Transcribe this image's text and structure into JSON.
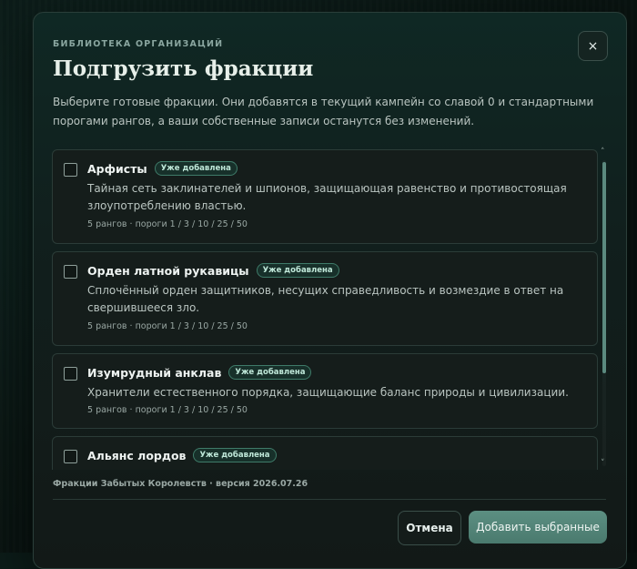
{
  "dialog": {
    "eyebrow": "БИБЛИОТЕКА ОРГАНИЗАЦИЙ",
    "title": "Подгрузить фракции",
    "description": "Выберите готовые фракции. Они добавятся в текущий кампейн со славой 0 и стандартными порогами рангов, а ваши собственные записи останутся без изменений.",
    "close_icon": "×"
  },
  "factions": [
    {
      "name": "Арфисты",
      "badge": "Уже добавлена",
      "description": "Тайная сеть заклинателей и шпионов, защищающая равенство и противостоящая злоупотреблению властью.",
      "meta": "5 рангов · пороги 1 / 3 / 10 / 25 / 50",
      "checked": false
    },
    {
      "name": "Орден латной рукавицы",
      "badge": "Уже добавлена",
      "description": "Сплочённый орден защитников, несущих справедливость и возмездие в ответ на свершившееся зло.",
      "meta": "5 рангов · пороги 1 / 3 / 10 / 25 / 50",
      "checked": false
    },
    {
      "name": "Изумрудный анклав",
      "badge": "Уже добавлена",
      "description": "Хранители естественного порядка, защищающие баланс природы и цивилизации.",
      "meta": "5 рангов · пороги 1 / 3 / 10 / 25 / 50",
      "checked": false
    },
    {
      "name": "Альянс лордов",
      "badge": "Уже добавлена",
      "checked": false
    }
  ],
  "footer": {
    "source": "Фракции Забытых Королевств · версия 2026.07.26",
    "cancel_label": "Отмена",
    "add_label": "Добавить выбранные"
  },
  "scroll": {
    "up_icon": "˄",
    "down_icon": "˅"
  },
  "colors": {
    "accent": "#5c8f82",
    "badge_border": "#3f7b69",
    "background": "#0a1613"
  }
}
